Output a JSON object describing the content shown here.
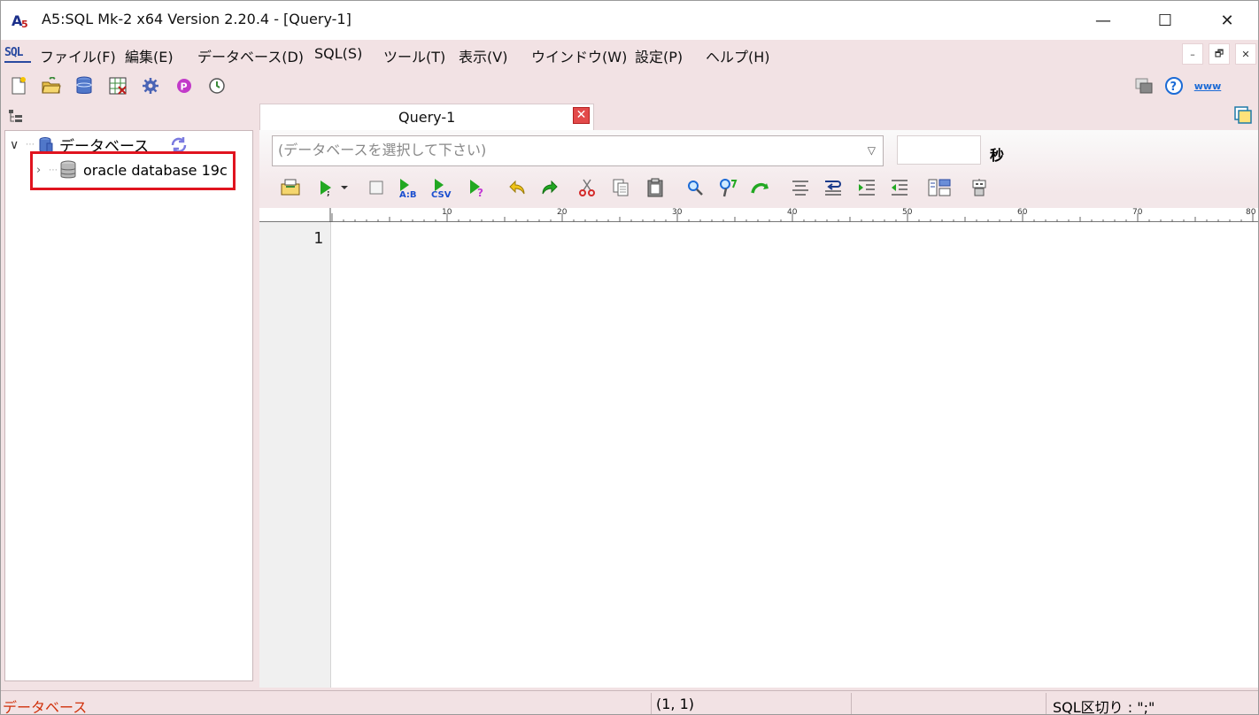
{
  "window": {
    "title": "A5:SQL Mk-2 x64 Version 2.20.4 - [Query-1]",
    "controls": {
      "minimize": "—",
      "maximize": "☐",
      "close": "✕"
    }
  },
  "menubar": {
    "logo": "SQL",
    "items": [
      "ファイル(F)",
      "編集(E)",
      "データベース(D)",
      "SQL(S)",
      "ツール(T)",
      "表示(V)",
      "ウインドウ(W)",
      "設定(P)",
      "ヘルプ(H)"
    ],
    "mdi": {
      "minimize": "–",
      "restore": "🗗",
      "close": "✕"
    }
  },
  "toolbar": {
    "icons": [
      "new-file-icon",
      "open-folder-icon",
      "database-icon",
      "table-grid-icon",
      "gear-icon",
      "plugin-icon",
      "clock-icon"
    ],
    "right_icons": [
      "window-icon",
      "help-icon",
      "www-icon"
    ],
    "www_label": "www",
    "help_label": "?"
  },
  "tree": {
    "root_label": "データベース",
    "items": [
      {
        "label": "oracle database 19c"
      }
    ]
  },
  "tab": {
    "label": "Query-1",
    "close": "✕"
  },
  "query": {
    "db_select_placeholder": "(データベースを選択して下さい)",
    "timeout_value": "",
    "seconds_label": "秒",
    "icons": [
      "open-sql-icon",
      "run-icon",
      "stop-icon",
      "run-ab-icon",
      "run-csv-icon",
      "explain-icon",
      "undo-icon",
      "redo-icon",
      "cut-icon",
      "copy-icon",
      "paste-icon",
      "find-icon",
      "find-replace-icon",
      "jump-icon",
      "format-icon",
      "wrap-icon",
      "indent-icon",
      "unindent-icon",
      "layout-icon",
      "robot-icon"
    ],
    "icon_text": {
      "ab": "A:B",
      "csv": "CSV",
      "explain": "?"
    },
    "ruler": [
      "10",
      "20",
      "30",
      "40",
      "50",
      "60",
      "70",
      "80"
    ],
    "line_numbers": [
      "1"
    ]
  },
  "status": {
    "left": "データベース",
    "position": "(1, 1)",
    "separator": "SQL区切り : \";\""
  },
  "colors": {
    "chrome": "#f2e2e4",
    "highlight": "#e0141f",
    "status_left": "#d0300a",
    "accent_blue": "#2a4aa0"
  }
}
